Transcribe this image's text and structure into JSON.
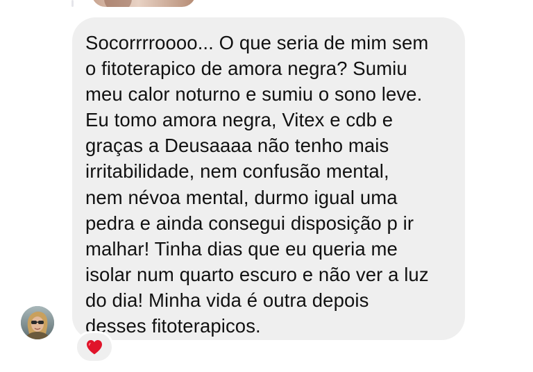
{
  "message": {
    "lines": [
      "Socorrrroooo... O que seria de mim sem",
      "o fitoterapico de amora negra? Sumiu",
      "meu calor noturno e sumiu o sono leve.",
      "Eu tomo amora negra, Vitex e cdb e",
      "graças a Deusaaaa não tenho mais",
      "irritabilidade, nem confusão mental,",
      "nem névoa mental, durmo igual uma",
      "pedra e ainda consegui disposição p ir",
      "malhar! Tinha dias que eu queria me",
      "isolar num quarto escuro e não ver a luz",
      "do dia! Minha vida é outra depois",
      "desses fitoterapicos."
    ],
    "bubble_color": "#efefef",
    "text_color": "#111111"
  },
  "sender": {
    "avatar_icon": "profile-photo-avatar"
  },
  "reaction": {
    "icon": "red-heart-icon",
    "color": "#e0142a"
  },
  "previous_message": {
    "type": "photo-attachment"
  }
}
